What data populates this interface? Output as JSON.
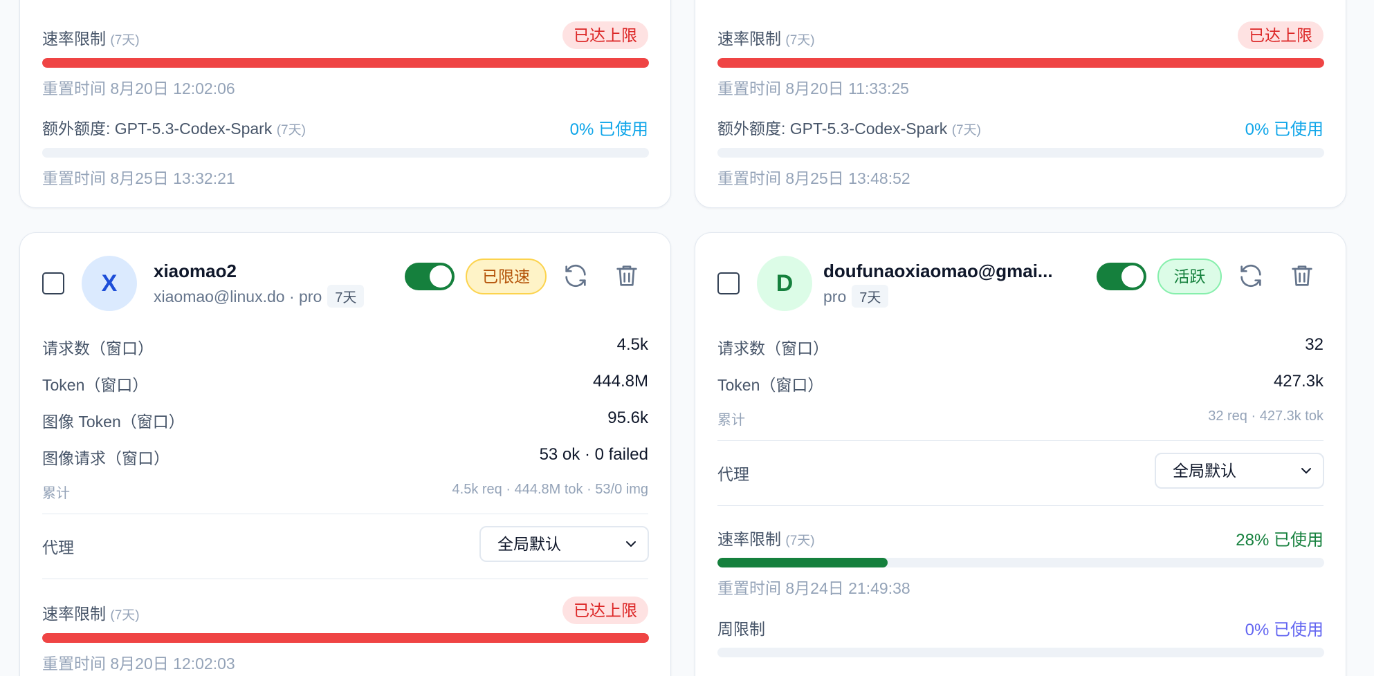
{
  "top_left": {
    "rate_label": "速率限制",
    "rate_window": "(7天)",
    "rate_badge": "已达上限",
    "rate_reset": "重置时间 8月20日 12:02:06",
    "extra_label": "额外额度: GPT-5.3-Codex-Spark",
    "extra_window": "(7天)",
    "extra_pct": "0% 已使用",
    "extra_reset": "重置时间 8月25日 13:32:21"
  },
  "top_right": {
    "rate_label": "速率限制",
    "rate_window": "(7天)",
    "rate_badge": "已达上限",
    "rate_reset": "重置时间 8月20日 11:33:25",
    "extra_label": "额外额度: GPT-5.3-Codex-Spark",
    "extra_window": "(7天)",
    "extra_pct": "0% 已使用",
    "extra_reset": "重置时间 8月25日 13:48:52"
  },
  "account_left": {
    "avatar_letter": "X",
    "name": "xiaomao2",
    "sub": "xiaomao@linux.do · pro",
    "period": "7天",
    "enabled": true,
    "status": "已限速",
    "stats": [
      {
        "label": "请求数（窗口）",
        "value": "4.5k"
      },
      {
        "label": "Token（窗口）",
        "value": "444.8M"
      },
      {
        "label": "图像 Token（窗口）",
        "value": "95.6k"
      },
      {
        "label": "图像请求（窗口）",
        "value": "53 ok · 0 failed"
      }
    ],
    "total_label": "累计",
    "total_value": "4.5k req · 444.8M tok · 53/0 img",
    "proxy_label": "代理",
    "proxy_value": "全局默认",
    "rate_label": "速率限制",
    "rate_window": "(7天)",
    "rate_badge": "已达上限",
    "rate_fill": 1.0,
    "rate_reset": "重置时间 8月20日 12:02:03"
  },
  "account_right": {
    "avatar_letter": "D",
    "name": "doufunaoxiaomao@gmai...",
    "sub": "pro",
    "period": "7天",
    "enabled": true,
    "status": "活跃",
    "stats": [
      {
        "label": "请求数（窗口）",
        "value": "32"
      },
      {
        "label": "Token（窗口）",
        "value": "427.3k"
      }
    ],
    "total_label": "累计",
    "total_value": "32 req · 427.3k tok",
    "proxy_label": "代理",
    "proxy_value": "全局默认",
    "rate_label": "速率限制",
    "rate_window": "(7天)",
    "rate_pct": "28% 已使用",
    "rate_fill": 0.28,
    "rate_reset": "重置时间 8月24日 21:49:38",
    "week_label": "周限制",
    "week_pct": "0% 已使用",
    "week_fill": 0.0
  },
  "colors": {
    "danger": "#ef4444",
    "success": "#15803d",
    "info": "#0ea5e9",
    "indigo": "#6366f1"
  },
  "icons": [
    "refresh-icon",
    "trash-icon",
    "chevron-down-icon"
  ]
}
